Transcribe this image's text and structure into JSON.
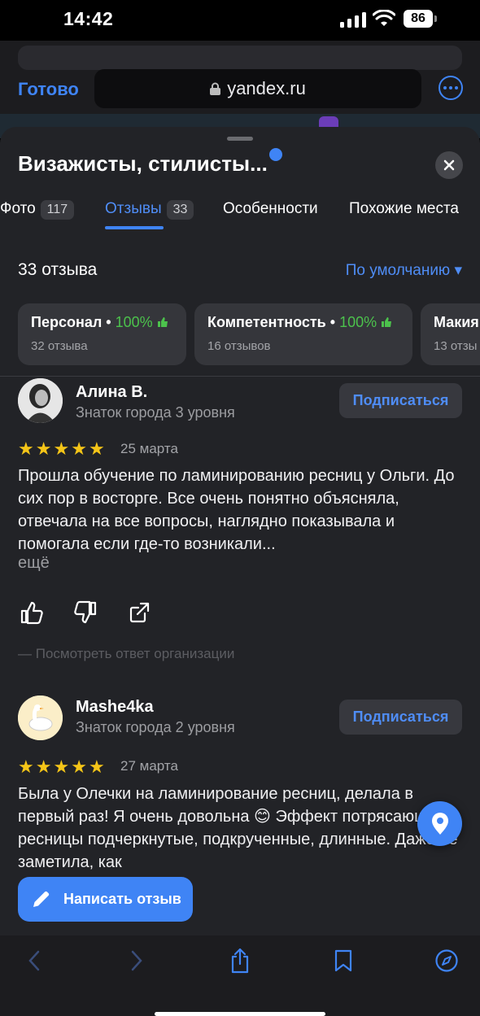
{
  "status": {
    "time": "14:42",
    "battery": "86"
  },
  "browser": {
    "done_label": "Готово",
    "url": "yandex.ru"
  },
  "place": {
    "title": "Визажисты, стилисты..."
  },
  "tabs": [
    {
      "label": "Фото",
      "count": "117"
    },
    {
      "label": "Отзывы",
      "count": "33"
    },
    {
      "label": "Особенности"
    },
    {
      "label": "Похожие места"
    }
  ],
  "summary": {
    "count_label": "33 отзыва",
    "sort_label": "По умолчанию ▾"
  },
  "aspects": [
    {
      "name": "Персонал •",
      "percent": "100%",
      "reviews": "32 отзыва"
    },
    {
      "name": "Компетентность •",
      "percent": "100%",
      "reviews": "16 отзывов"
    },
    {
      "name": "Макия",
      "percent": "",
      "reviews": "13 отзы"
    }
  ],
  "reviews": [
    {
      "author": "Алина В.",
      "level": "Знаток города 3 уровня",
      "subscribe": "Подписаться",
      "rating": 5,
      "date": "25 марта",
      "text": "Прошла обучение по ламинированию ресниц у Ольги. До сих пор в восторге. Все очень понятно объясняла, отвечала на все вопросы, наглядно показывала и помогала если где-то возникали...",
      "more": "ещё",
      "org_reply": "—  Посмотреть ответ организации"
    },
    {
      "author": "Mashe4ka",
      "level": "Знаток города 2 уровня",
      "subscribe": "Подписаться",
      "rating": 5,
      "date": "27 марта",
      "text": "Была у Олечки на ламинирование ресниц, делала в первый раз! Я очень довольна 😊 Эффект потрясающий, ресницы подчеркнутые, подкрученные, длинные. Даже не заметила, как"
    }
  ],
  "write_review_label": "Написать отзыв",
  "colors": {
    "accent": "#3f84f5",
    "positive": "#4cc24c",
    "star": "#f5c518",
    "sheet_bg": "#222327"
  }
}
